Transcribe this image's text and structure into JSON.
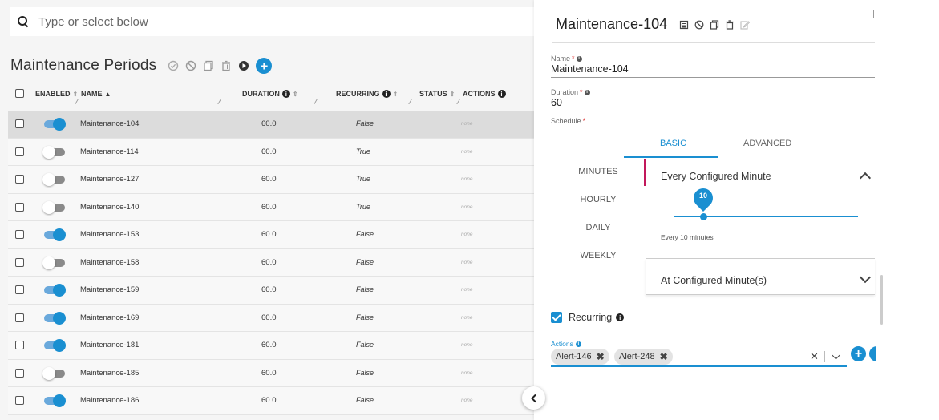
{
  "search": {
    "placeholder": "Type or select below"
  },
  "list": {
    "title": "Maintenance Periods",
    "add_label": "+",
    "columns": {
      "enabled": "ENABLED",
      "name": "NAME",
      "duration": "DURATION",
      "recurring": "RECURRING",
      "status": "STATUS",
      "actions": "ACTIONS"
    },
    "rows": [
      {
        "enabled": true,
        "name": "Maintenance-104",
        "duration": "60.0",
        "recurring": "False",
        "status": "none",
        "selected": true
      },
      {
        "enabled": false,
        "name": "Maintenance-114",
        "duration": "60.0",
        "recurring": "True",
        "status": "none"
      },
      {
        "enabled": false,
        "name": "Maintenance-127",
        "duration": "60.0",
        "recurring": "True",
        "status": "none"
      },
      {
        "enabled": false,
        "name": "Maintenance-140",
        "duration": "60.0",
        "recurring": "True",
        "status": "none"
      },
      {
        "enabled": true,
        "name": "Maintenance-153",
        "duration": "60.0",
        "recurring": "False",
        "status": "none"
      },
      {
        "enabled": false,
        "name": "Maintenance-158",
        "duration": "60.0",
        "recurring": "False",
        "status": "none"
      },
      {
        "enabled": true,
        "name": "Maintenance-159",
        "duration": "60.0",
        "recurring": "False",
        "status": "none"
      },
      {
        "enabled": true,
        "name": "Maintenance-169",
        "duration": "60.0",
        "recurring": "False",
        "status": "none"
      },
      {
        "enabled": true,
        "name": "Maintenance-181",
        "duration": "60.0",
        "recurring": "False",
        "status": "none"
      },
      {
        "enabled": false,
        "name": "Maintenance-185",
        "duration": "60.0",
        "recurring": "False",
        "status": "none"
      },
      {
        "enabled": true,
        "name": "Maintenance-186",
        "duration": "60.0",
        "recurring": "False",
        "status": "none"
      }
    ]
  },
  "detail": {
    "title": "Maintenance-104",
    "name_label": "Name",
    "name_value": "Maintenance-104",
    "duration_label": "Duration",
    "duration_value": "60",
    "schedule_label": "Schedule",
    "required_mark": "*",
    "info_glyph": "i",
    "tabs": {
      "basic": "BASIC",
      "advanced": "ADVANCED"
    },
    "units": [
      "MINUTES",
      "HOURLY",
      "DAILY",
      "WEEKLY"
    ],
    "every_configured_minute": "Every Configured Minute",
    "slider_value": "10",
    "slider_caption": "Every 10 minutes",
    "at_configured_minutes": "At Configured Minute(s)",
    "recurring_label": "Recurring",
    "recurring_checked": true,
    "actions_label": "Actions",
    "chips": [
      "Alert-146",
      "Alert-248"
    ],
    "chip_remove": "✖",
    "clear_all": "✕",
    "add_action": "+"
  },
  "colors": {
    "accent": "#1a8fd1",
    "tab_indicator": "#c2185b"
  }
}
